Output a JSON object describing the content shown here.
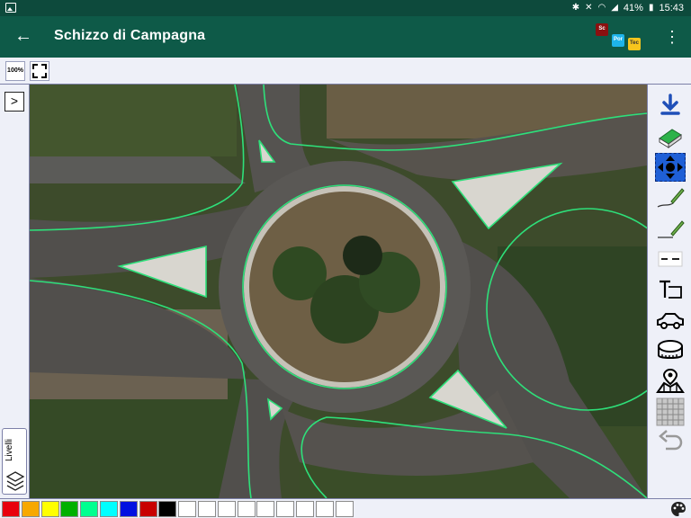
{
  "status": {
    "icons": [
      "image-icon",
      "bluetooth-icon",
      "mute-icon",
      "wifi-icon",
      "signal-icon",
      "battery-icon"
    ],
    "battery": "41%",
    "time": "15:43"
  },
  "appbar": {
    "title": "Schizzo di Campagna",
    "logo": {
      "sq1": "Sc",
      "sq2": "Por",
      "sq3": "Tec"
    }
  },
  "toolbar": {
    "zoom_100_label": "100%"
  },
  "layers": {
    "label": "Livelli"
  },
  "tools": [
    "download-icon",
    "eraser-icon",
    "move-icon",
    "pen-icon",
    "pencil-icon",
    "dashed-line-icon",
    "text-tool-icon",
    "car-icon",
    "measure-tape-icon",
    "map-marker-icon",
    "grid-icon",
    "undo-icon"
  ],
  "palette": {
    "colors": [
      "#e8000d",
      "#f7a800",
      "#ffff00",
      "#00b000",
      "#00ff90",
      "#00ffff",
      "#0010e0",
      "#c80000",
      "#000000",
      "#ffffff",
      "#ffffff",
      "#ffffff",
      "#ffffff",
      "#ffffff",
      "#ffffff",
      "#ffffff",
      "#ffffff",
      "#ffffff"
    ]
  },
  "colors": {
    "statusbar": "#0d4a3c",
    "appbar": "#0e5a48",
    "sketch_line": "#2ee07a",
    "active_tool": "#1f5fd6"
  }
}
